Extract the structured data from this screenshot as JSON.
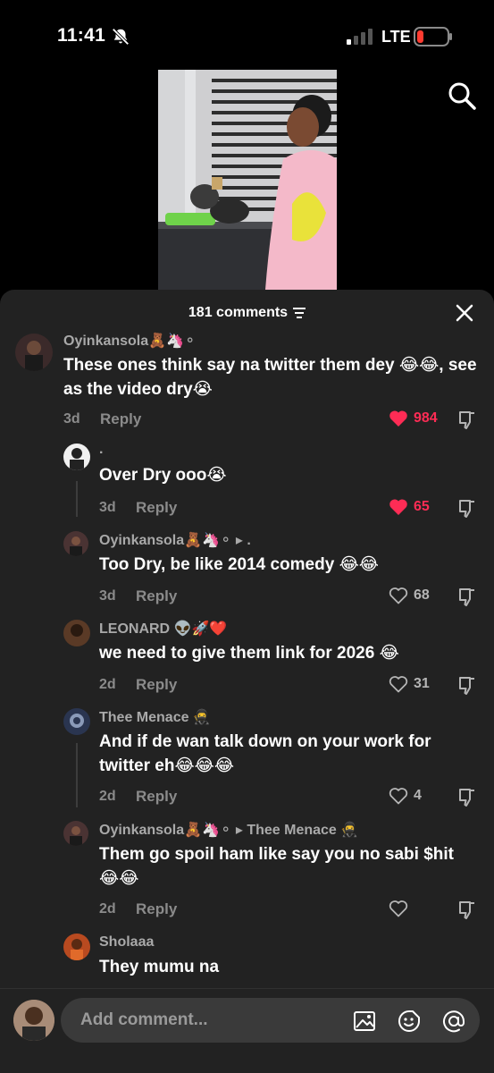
{
  "status": {
    "time": "11:41",
    "carrier": "LTE"
  },
  "header": {
    "count_label": "181 comments"
  },
  "comments": [
    {
      "username": "Oyinkansola🧸🦄⚬",
      "text": "These ones think say na twitter them dey 😂😂, see as the video dry😭",
      "time": "3d",
      "reply": "Reply",
      "likes": "984",
      "liked": true
    },
    {
      "username": ".",
      "text": "Over Dry ooo😭",
      "time": "3d",
      "reply": "Reply",
      "likes": "65",
      "liked": true
    },
    {
      "username": "Oyinkansola🧸🦄⚬ ▸ .",
      "text": "Too Dry, be like 2014 comedy 😂😂",
      "time": "3d",
      "reply": "Reply",
      "likes": "68",
      "liked": false
    },
    {
      "username": "LEONARD 👽🚀❤️",
      "text": "we need to give them link for 2026 😂",
      "time": "2d",
      "reply": "Reply",
      "likes": "31",
      "liked": false
    },
    {
      "username": "Thee Menace 🥷",
      "text": "And if de wan talk down on your work for twitter eh😂😂😂",
      "time": "2d",
      "reply": "Reply",
      "likes": "4",
      "liked": false
    },
    {
      "username": "Oyinkansola🧸🦄⚬ ▸ Thee Menace 🥷",
      "text": "Them go spoil ham like say you no sabi $hit 😂😂",
      "time": "2d",
      "reply": "Reply",
      "likes": "",
      "liked": false
    },
    {
      "username": "Sholaaa",
      "text": "They mumu na",
      "time": "",
      "reply": "",
      "likes": "",
      "liked": false
    }
  ],
  "composer": {
    "placeholder": "Add comment..."
  },
  "colors": {
    "sheet_bg": "#222222",
    "liked": "#fe2c55",
    "input_bg": "#3a3a3a"
  },
  "icons": [
    "bell-slash-icon",
    "signal-icon",
    "battery-icon",
    "search-icon",
    "sort-icon",
    "close-icon",
    "heart-icon",
    "dislike-icon",
    "image-icon",
    "emoji-icon",
    "mention-icon"
  ]
}
